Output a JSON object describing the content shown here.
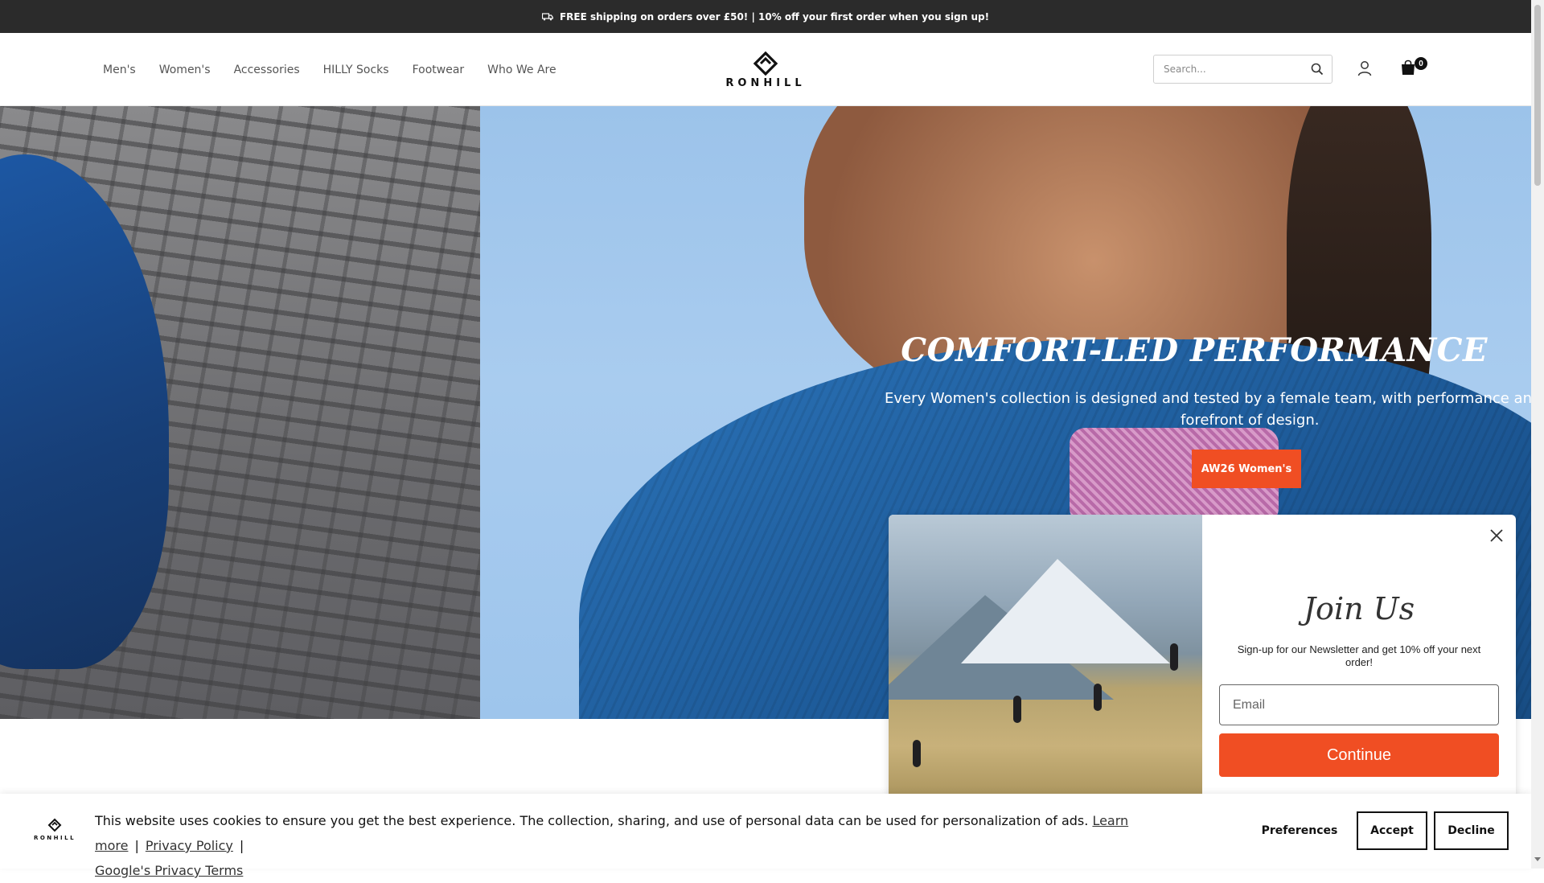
{
  "announcement": {
    "text": "FREE shipping on orders over £50! | 10% off your first order when you sign up!"
  },
  "nav": {
    "items": [
      "Men's",
      "Women's",
      "Accessories",
      "HILLY Socks",
      "Footwear",
      "Who We Are"
    ]
  },
  "logo": {
    "text": "RONHILL"
  },
  "search": {
    "placeholder": "Search..."
  },
  "cart": {
    "count": "0"
  },
  "hero": {
    "title": "COMFORT-LED PERFORMANCE",
    "subtitle_line1": "Every Women's collection is designed and tested by a female team, with performance and com",
    "subtitle_line2": "forefront of design.",
    "button_label": "AW26 Women's"
  },
  "popup": {
    "title": "Join Us",
    "text": "Sign-up for our Newsletter and get 10% off your next order!",
    "email_placeholder": "Email",
    "continue_label": "Continue"
  },
  "cookie": {
    "text": "This website uses cookies to ensure you get the best experience. The collection, sharing, and use of personal data can be used for personalization of ads.",
    "learn_more": "Learn more",
    "sep": "|",
    "privacy_policy": "Privacy Policy",
    "google_terms": "Google's Privacy Terms",
    "preferences_label": "Preferences",
    "accept_label": "Accept",
    "decline_label": "Decline"
  },
  "colors": {
    "accent": "#f04e23",
    "announcement_bg": "#2b2b2b"
  }
}
